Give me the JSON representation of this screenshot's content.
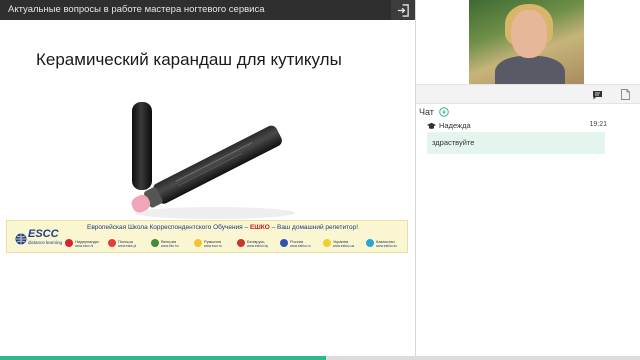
{
  "window": {
    "title": "Актуальные вопросы в работе мастера ногтевого сервиса"
  },
  "slide": {
    "title": "Керамический карандаш для кутикулы",
    "banner": {
      "logo": "ESCC",
      "logo_sub": "distance learning",
      "slogan_left": "Европейская Школа Корреспондентского Обучения –",
      "slogan_brand": "ЕШКО",
      "slogan_right": "– Ваш домашний репетитор!",
      "countries": [
        {
          "name": "Нидерланды",
          "url": "www.escc.nl",
          "color": "#d5232f"
        },
        {
          "name": "Польша",
          "url": "www.eskk.pl",
          "color": "#e53b3b"
        },
        {
          "name": "Венгрия",
          "url": "www.ekc.hu",
          "color": "#3c8e3c"
        },
        {
          "name": "Румыния",
          "url": "www.eccr.ro",
          "color": "#f2c230"
        },
        {
          "name": "Беларусь",
          "url": "www.eshko.by",
          "color": "#c8372d"
        },
        {
          "name": "Россия",
          "url": "www.eshko.ru",
          "color": "#2d55b0"
        },
        {
          "name": "Украина",
          "url": "www.eshko.ua",
          "color": "#f2cf2a"
        },
        {
          "name": "Казахстан",
          "url": "www.eshko.kz",
          "color": "#2aa3d6"
        }
      ]
    }
  },
  "progress": {
    "fraction": 0.51
  },
  "chat": {
    "header": "Чат",
    "messages": [
      {
        "author": "Надежда",
        "time": "19:21",
        "text": "здраствуйте"
      }
    ]
  },
  "icons": {
    "exit": "exit-icon",
    "chat_tab": "chat-bubble-icon",
    "files_tab": "document-icon",
    "info": "info-circle-icon",
    "user": "graduation-cap-icon"
  },
  "colors": {
    "topbar": "#2f2f2f",
    "accent": "#2fb98a",
    "bubble": "#e4f5ee"
  }
}
